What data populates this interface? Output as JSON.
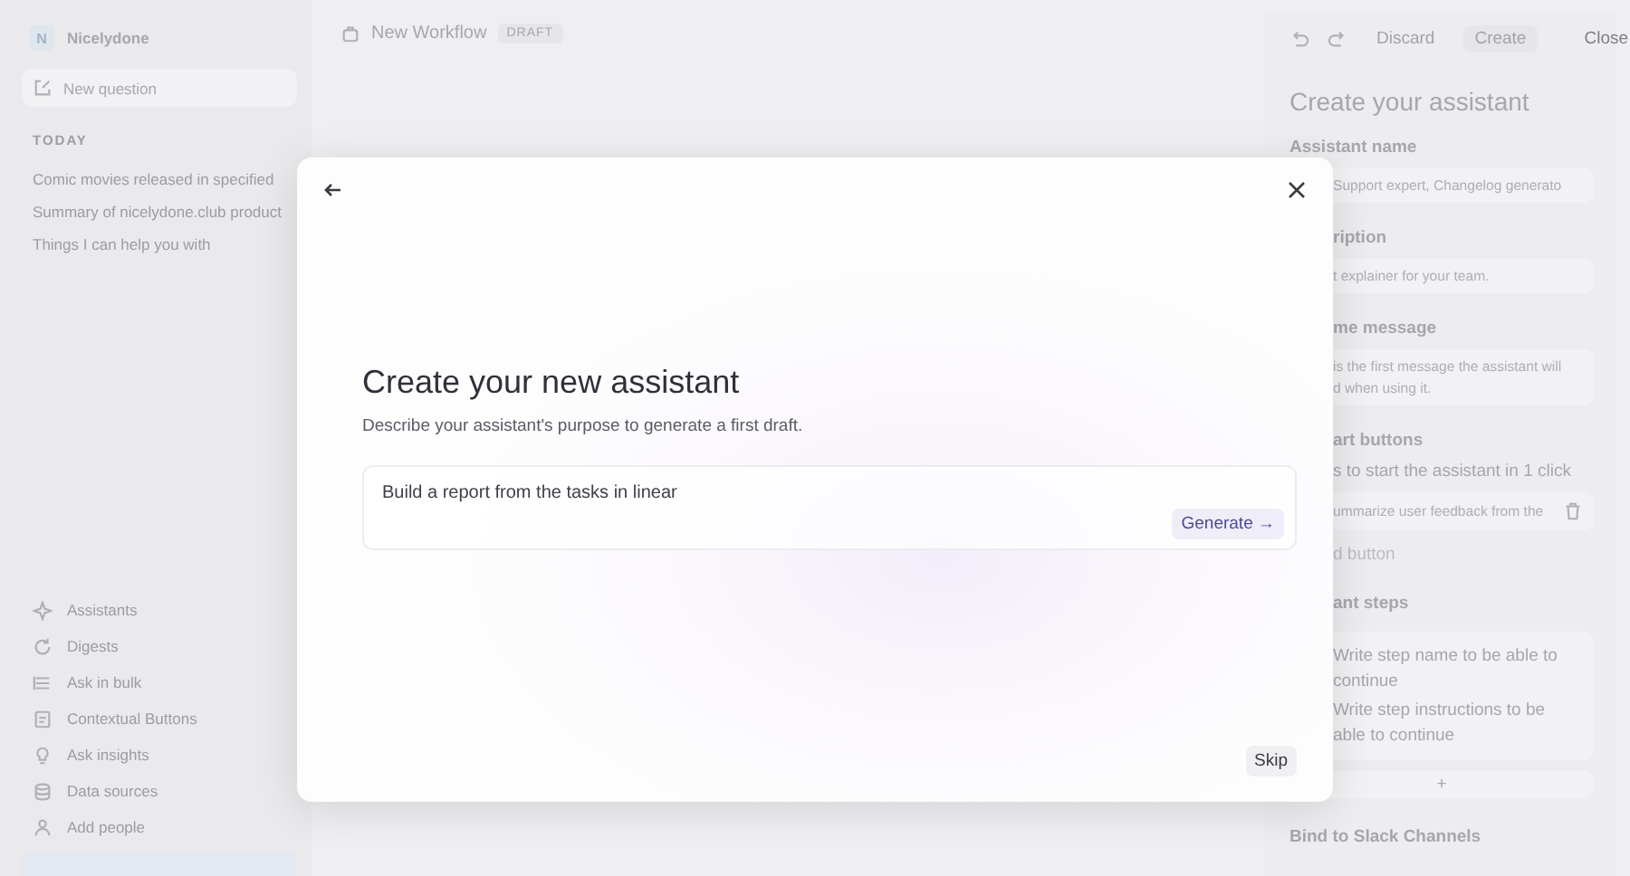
{
  "sidebar": {
    "brand_initial": "N",
    "brand": "Nicelydone",
    "new_question": "New question",
    "section": "TODAY",
    "history": [
      "Comic movies released in specified",
      "Summary of nicelydone.club product",
      "Things I can help you with"
    ],
    "nav": [
      {
        "label": "Assistants"
      },
      {
        "label": "Digests"
      },
      {
        "label": "Ask in bulk"
      },
      {
        "label": "Contextual Buttons"
      },
      {
        "label": "Ask insights"
      },
      {
        "label": "Data sources"
      },
      {
        "label": "Add people"
      }
    ]
  },
  "header": {
    "title": "New Workflow",
    "badge": "DRAFT"
  },
  "panel": {
    "actions": [
      {
        "label": "Discard",
        "disabled": true
      },
      {
        "label": "Create",
        "disabled": true
      },
      {
        "label": "Close",
        "disabled": false
      }
    ],
    "heading": "Create your assistant",
    "name_label": "Assistant name",
    "name_placeholder": "Support expert, Changelog generato",
    "description_label": "ription",
    "description_placeholder": "t explainer for your team.",
    "welcome_label": "me message",
    "welcome_placeholder": [
      "is the first message the assistant will",
      "d when using it."
    ],
    "start_label": "art buttons",
    "start_hint": "s to start the assistant in 1 click",
    "start_items": [
      "ummarize user feedback from the"
    ],
    "add_button": "d button",
    "steps_label": "ant steps",
    "steps": [
      [
        "Write step name to be able to",
        "continue"
      ],
      [
        "Write step instructions to be",
        "able to continue"
      ]
    ],
    "add_step": "+",
    "slack_label": "Bind to Slack Channels"
  },
  "modal": {
    "title": "Create your new assistant",
    "subtitle": "Describe your assistant's purpose to generate a first draft.",
    "prompt_value": "Build a report from the tasks in linear",
    "generate": "Generate →",
    "skip": "Skip"
  }
}
